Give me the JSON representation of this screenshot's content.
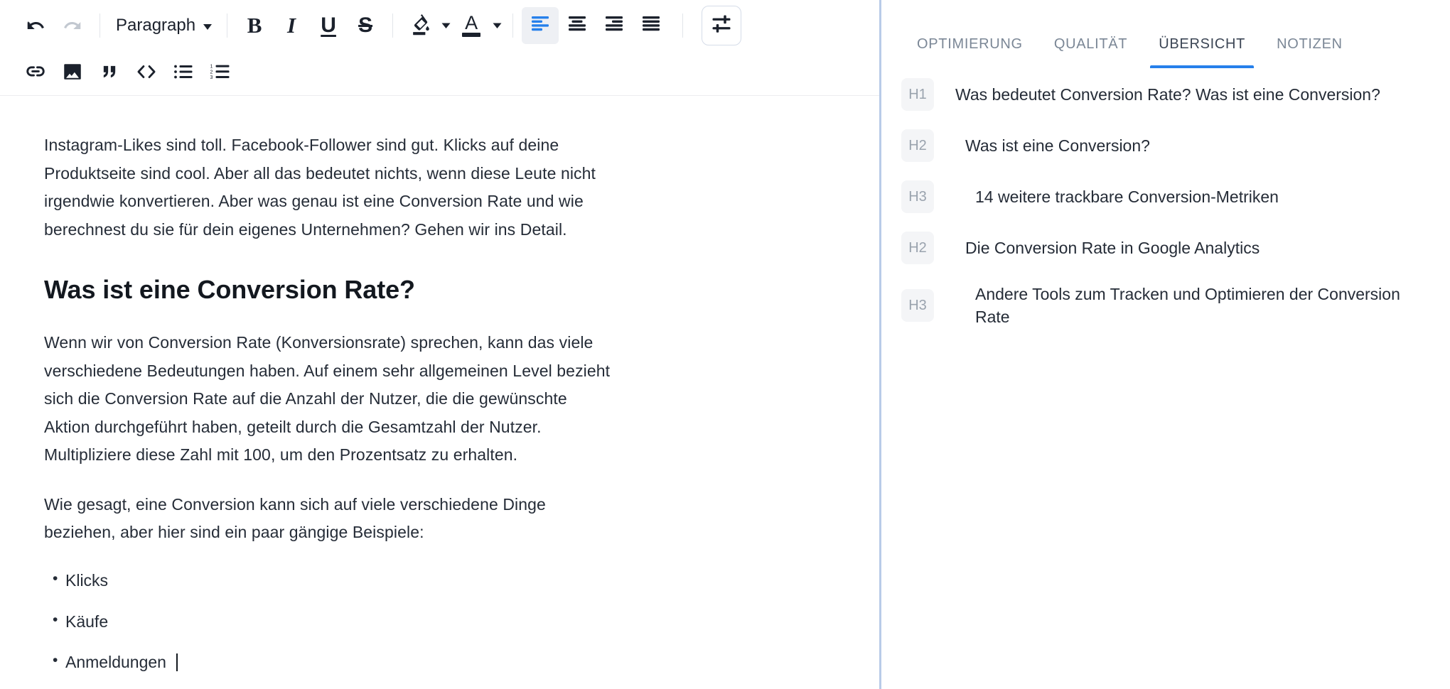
{
  "toolbar": {
    "row1": [
      {
        "name": "undo-button",
        "icon": "undo-icon",
        "state": "enabled"
      },
      {
        "name": "redo-button",
        "icon": "redo-icon",
        "state": "disabled"
      },
      {
        "name": "paragraph-style-select",
        "label": "Paragraph",
        "icon": "chevron-down-icon"
      },
      {
        "name": "bold-button",
        "icon": "bold-icon",
        "label": "B"
      },
      {
        "name": "italic-button",
        "icon": "italic-icon",
        "label": "I"
      },
      {
        "name": "underline-button",
        "icon": "underline-icon",
        "label": "U"
      },
      {
        "name": "strikethrough-button",
        "icon": "strikethrough-icon",
        "label": "S"
      },
      {
        "name": "highlight-color-button",
        "icon": "fill-color-icon"
      },
      {
        "name": "text-color-button",
        "icon": "text-color-icon",
        "label": "A"
      },
      {
        "name": "align-left-button",
        "icon": "align-left-icon",
        "state": "active"
      },
      {
        "name": "align-center-button",
        "icon": "align-center-icon"
      },
      {
        "name": "align-right-button",
        "icon": "align-right-icon"
      },
      {
        "name": "align-justify-button",
        "icon": "align-justify-icon"
      },
      {
        "name": "settings-button",
        "icon": "tune-sliders-icon"
      }
    ],
    "row2": [
      {
        "name": "insert-link-button",
        "icon": "link-icon"
      },
      {
        "name": "insert-image-button",
        "icon": "image-icon"
      },
      {
        "name": "blockquote-button",
        "icon": "quote-icon"
      },
      {
        "name": "code-block-button",
        "icon": "code-icon"
      },
      {
        "name": "bullet-list-button",
        "icon": "bulleted-list-icon"
      },
      {
        "name": "numbered-list-button",
        "icon": "numbered-list-icon"
      }
    ],
    "paragraph_label": "Paragraph",
    "bold_label": "B",
    "italic_label": "I",
    "underline_label": "U",
    "strike_label": "S",
    "text_color_label": "A",
    "accent_color": "#2680eb",
    "active_bg_color": "#eef0f4",
    "icon_color": "#1b212c",
    "disabled_color": "#c2c8d0"
  },
  "document": {
    "paragraph_1": "Instagram-Likes sind toll. Facebook-Follower sind gut. Klicks auf deine Produktseite sind cool. Aber all das bedeutet nichts, wenn diese Leute nicht irgendwie konvertieren. Aber was genau ist eine Conversion Rate und wie berechnest du sie für dein eigenes Unternehmen? Gehen wir ins Detail.",
    "heading_1": "Was ist eine Conversion Rate?",
    "paragraph_2": "Wenn wir von Conversion Rate (Konversionsrate) sprechen, kann das viele verschiedene Bedeutungen haben. Auf einem sehr allgemeinen Level bezieht sich die Conversion Rate auf die Anzahl der Nutzer, die die gewünschte Aktion durchgeführt haben, geteilt durch die Gesamtzahl der Nutzer. Multipliziere diese Zahl mit 100, um den Prozentsatz zu erhalten.",
    "paragraph_3": "Wie gesagt, eine Conversion kann sich auf viele verschiedene Dinge beziehen, aber hier sind ein paar gängige Beispiele:",
    "list": [
      "Klicks",
      "Käufe",
      "Anmeldungen"
    ],
    "caret_after_list_item": 2
  },
  "outline_panel": {
    "tabs": [
      {
        "label": "OPTIMIERUNG",
        "active": false
      },
      {
        "label": "QUALITÄT",
        "active": false
      },
      {
        "label": "ÜBERSICHT",
        "active": true
      },
      {
        "label": "NOTIZEN",
        "active": false
      }
    ],
    "items": [
      {
        "badge": "H1",
        "text": "Was bedeutet Conversion Rate? Was ist eine Conversion?",
        "level": 1
      },
      {
        "badge": "H2",
        "text": "Was ist eine Conversion?",
        "level": 2
      },
      {
        "badge": "H3",
        "text": "14 weitere trackbare Conversion-Metriken",
        "level": 3
      },
      {
        "badge": "H2",
        "text": "Die Conversion Rate in Google Analytics",
        "level": 2
      },
      {
        "badge": "H3",
        "text": "Andere Tools zum Tracken und Optimieren der Conversion Rate",
        "level": 3
      }
    ],
    "active_tab_color": "#2680eb",
    "badge_bg_color": "#f4f5f7",
    "badge_text_color": "#9aa3ae"
  }
}
